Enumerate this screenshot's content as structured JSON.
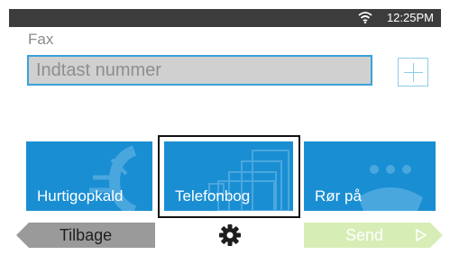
{
  "status_bar": {
    "time": "12:25PM",
    "wifi_icon": "wifi-icon"
  },
  "fax": {
    "label": "Fax",
    "input_placeholder": "Indtast nummer",
    "add_icon": "plus-icon"
  },
  "tiles": [
    {
      "label": "Hurtigopkald",
      "icon": "speed-dial-icon"
    },
    {
      "label": "Telefonbog",
      "icon": "phonebook-icon",
      "selected": true
    },
    {
      "label": "Rør på",
      "icon": "phone-hook-icon"
    }
  ],
  "footer": {
    "back_label": "Tilbage",
    "settings_icon": "gear-icon",
    "send_label": "Send",
    "send_icon": "play-arrow-icon"
  },
  "colors": {
    "tile_blue": "#1a8ed3",
    "input_border": "#3aa2d8",
    "send_disabled": "#d7edb6",
    "back_gray": "#9a9a9a"
  }
}
